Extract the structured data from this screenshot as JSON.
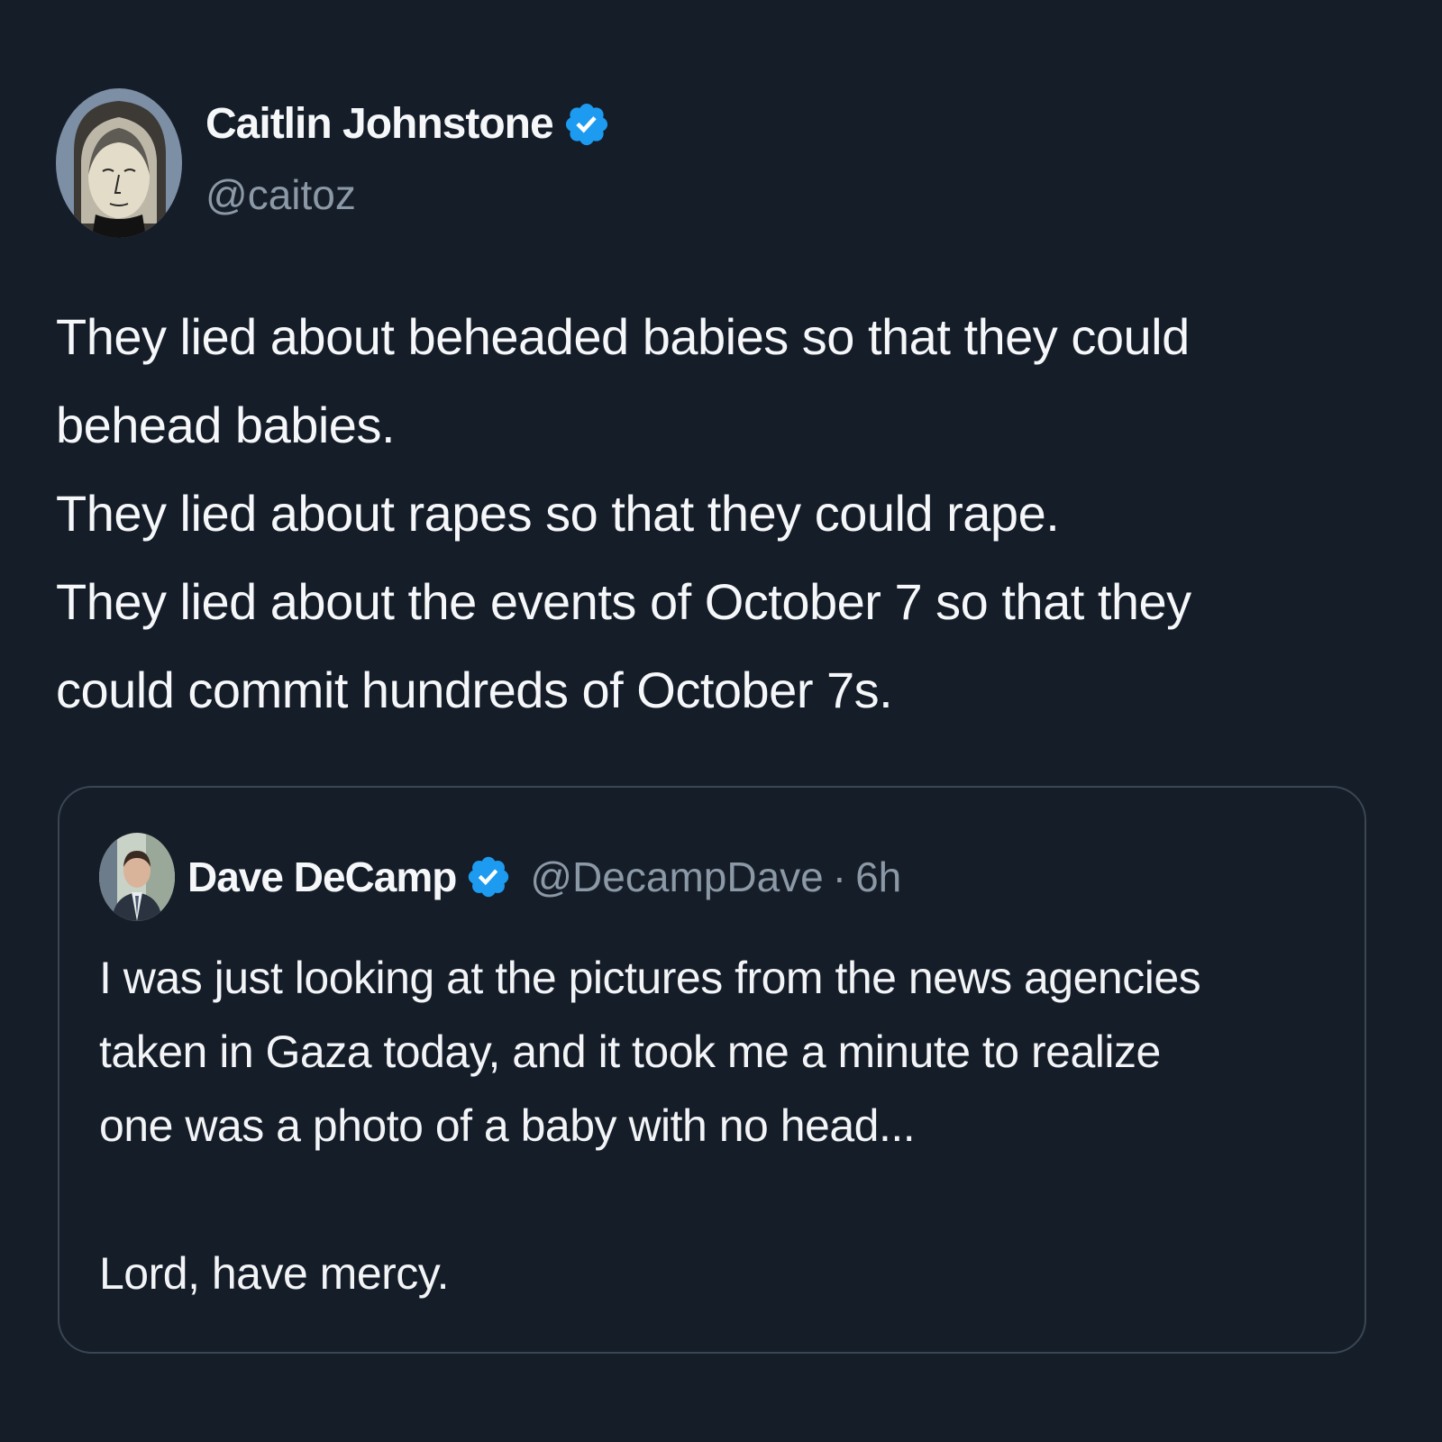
{
  "tweet": {
    "author": {
      "display_name": "Caitlin Johnstone",
      "handle": "@caitoz",
      "verified_icon": "verified-badge-icon"
    },
    "text_lines": [
      "They lied about beheaded babies so that they could",
      "behead babies.",
      "They lied about rapes so that they could rape.",
      "They lied about the events of October 7 so that they",
      "could commit hundreds of October 7s."
    ]
  },
  "quote": {
    "author": {
      "display_name": "Dave DeCamp",
      "handle": "@DecampDave",
      "separator": "·",
      "time": "6h"
    },
    "text_lines": [
      "I was just looking at the pictures from the news agencies",
      "taken in Gaza today, and it took me a minute to realize",
      "one was a photo of a baby with no head..."
    ],
    "closing_line": "Lord, have mercy."
  },
  "colors": {
    "background": "#151d29",
    "verified": "#1d9bf0",
    "secondary_text": "#8b98a5",
    "border": "#3a4654"
  }
}
